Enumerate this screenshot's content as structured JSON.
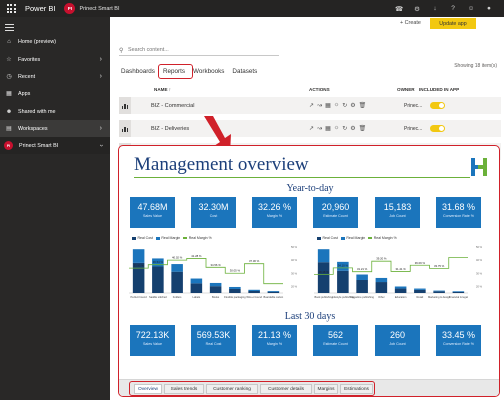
{
  "topbar": {
    "app_name": "Power BI",
    "workspace_badge": "PI",
    "workspace_name": "Prinect Smart BI",
    "icons": [
      "bell-icon",
      "gear-icon",
      "download-icon",
      "help-icon",
      "smiley-icon",
      "account-icon"
    ]
  },
  "nav": {
    "items": [
      {
        "label": "Home (preview)",
        "icon": "home-icon"
      },
      {
        "label": "Favorites",
        "icon": "star-icon"
      },
      {
        "label": "Recent",
        "icon": "clock-icon"
      },
      {
        "label": "Apps",
        "icon": "apps-icon"
      },
      {
        "label": "Shared with me",
        "icon": "shared-icon"
      },
      {
        "label": "Workspaces",
        "icon": "workspaces-icon"
      }
    ],
    "current_workspace": {
      "badge": "PI",
      "label": "Prinect Smart BI"
    }
  },
  "toolbar": {
    "create_label": "+ Create",
    "update_app_label": "Update app"
  },
  "search": {
    "placeholder": "Search content..."
  },
  "content": {
    "showing": "Showing 18 item(s)",
    "tabs": [
      "Dashboards",
      "Reports",
      "Workbooks",
      "Datasets"
    ],
    "columns": {
      "name": "NAME ↑",
      "actions": "ACTIONS",
      "owner": "OWNER",
      "included": "INCLUDED IN APP"
    },
    "rows": [
      {
        "name": "BIZ - Commercial",
        "owner": "Prinec...",
        "included": true
      },
      {
        "name": "BIZ - Deliveries",
        "owner": "Prinec...",
        "included": true
      }
    ]
  },
  "report": {
    "title": "Management overview",
    "ytd_title": "Year-to-day",
    "ytd_cards": [
      {
        "value": "47.68M",
        "label": "Sales Value"
      },
      {
        "value": "32.30M",
        "label": "Cost"
      },
      {
        "value": "32.26 %",
        "label": "Margin %"
      },
      {
        "value": "20,960",
        "label": "Estimate Count"
      },
      {
        "value": "15,183",
        "label": "Job Count"
      },
      {
        "value": "31.68 %",
        "label": "Conversion Rate %"
      }
    ],
    "last30_title": "Last 30 days",
    "last30_cards": [
      {
        "value": "722.13K",
        "label": "Sales Value"
      },
      {
        "value": "569.53K",
        "label": "Real Cost"
      },
      {
        "value": "21.13 %",
        "label": "Margin %"
      },
      {
        "value": "562",
        "label": "Estimate Count"
      },
      {
        "value": "260",
        "label": "Job Count"
      },
      {
        "value": "33.45 %",
        "label": "Conversion Rate %"
      }
    ],
    "tabs": [
      "Overview",
      "Sales trends",
      "Customer ranking",
      "Customer details",
      "Margins",
      "Estimations"
    ],
    "selected_tab": "Overview"
  },
  "chart_data": [
    {
      "type": "bar",
      "legend": [
        "Real Cost",
        "Real Margin",
        "Real Margin %"
      ],
      "categories": [
        "Perfect bound",
        "Saddle stitched",
        "Folders",
        "Labels",
        "Books",
        "Flexible packaging",
        "Wire-o bound",
        "Boardable carton"
      ],
      "series": [
        {
          "name": "Real Cost",
          "values": [
            7.5,
            6.6,
            5.3,
            2.4,
            1.7,
            1.0,
            0.5,
            0.3
          ]
        },
        {
          "name": "Real Margin",
          "values": [
            3.4,
            2.0,
            1.9,
            1.2,
            0.8,
            0.5,
            0.3,
            0.2
          ]
        },
        {
          "name": "Real Margin %",
          "values": [
            33.93,
            36.54,
            40.02,
            41.28,
            34.56,
            30.05,
            37.3,
            22.1
          ]
        }
      ],
      "data_labels": [
        "33.93 %",
        "36.54 %",
        "40.02 %",
        "41.28 %",
        "34.56 %",
        "30.05 %",
        "37.30 %"
      ]
    },
    {
      "type": "bar",
      "legend": [
        "Real Cost",
        "Real Margin",
        "Real Margin %"
      ],
      "categories": [
        "Book publishing",
        "Lifestyle publishing",
        "Magazine publishing",
        "Other",
        "Education",
        "Retail",
        "Marketing & design",
        "Financial & legal"
      ],
      "series": [
        {
          "name": "Real Cost",
          "values": [
            9.0,
            6.5,
            3.8,
            3.2,
            1.3,
            0.9,
            0.5,
            0.3
          ]
        },
        {
          "name": "Real Margin",
          "values": [
            3.8,
            2.6,
            1.6,
            1.2,
            0.6,
            0.4,
            0.2,
            0.2
          ]
        },
        {
          "name": "Real Margin %",
          "values": [
            29.16,
            34.1,
            31.21,
            39.2,
            31.41,
            36.09,
            33.75,
            42.0
          ]
        }
      ],
      "data_labels": [
        "29.16 %",
        "34.10 %",
        "31.21 %",
        "39.20 %",
        "31.41 %",
        "36.09 %",
        "33.75 %"
      ]
    }
  ]
}
